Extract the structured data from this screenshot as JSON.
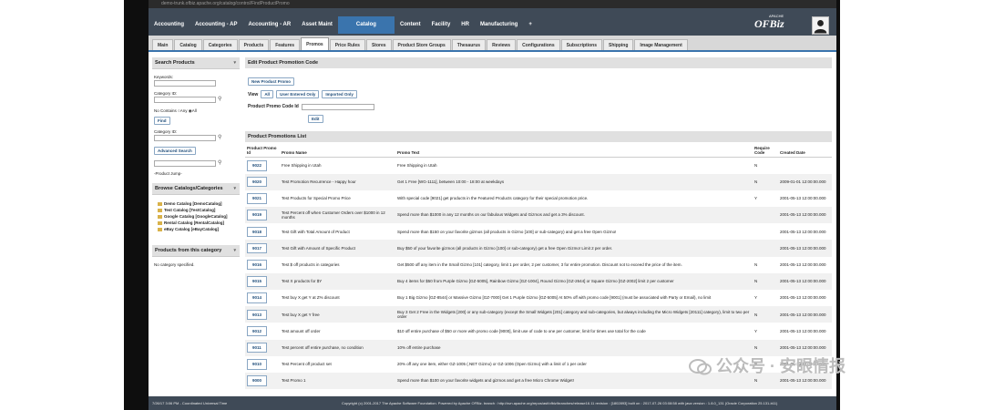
{
  "browser": {
    "url": "demo-trunk.ofbiz.apache.org/catalog/control/FindProductPromo"
  },
  "app_menu": {
    "items": [
      "Accounting",
      "Accounting - AP",
      "Accounting - AR",
      "Asset Maint",
      "Catalog",
      "Content",
      "Facility",
      "HR",
      "Manufacturing",
      "+"
    ],
    "active": "Catalog"
  },
  "brand": {
    "apache": "APACHE",
    "name": "OFBiz"
  },
  "tabs": [
    "Main",
    "Catalog",
    "Categories",
    "Products",
    "Features",
    "Promos",
    "Price Rules",
    "Stores",
    "Product Store Groups",
    "Thesaurus",
    "Reviews",
    "Configurations",
    "Subscriptions",
    "Shipping",
    "Image Management"
  ],
  "active_tab": "Promos",
  "search_products": {
    "title": "Search Products",
    "keywords_label": "Keywords:",
    "category_label": "Category ID:",
    "no_contains": "No Contains",
    "any": "Any",
    "all": "All",
    "find_btn": "Find",
    "category_label2": "Category ID:",
    "advanced_btn": "Advanced Search",
    "product_jump": "-Product Jump-"
  },
  "browse_catalogs": {
    "title": "Browse Catalogs/Categories",
    "items": [
      "Demo Catalog [DemoCatalog]",
      "Test Catalog [TestCatalog]",
      "Google Catalog [GoogleCatalog]",
      "Rental Catalog [RentalCatalog]",
      "eBay Catalog [eBayCatalog]"
    ]
  },
  "products_category": {
    "title": "Products from this category",
    "empty": "No category specified."
  },
  "edit_promo": {
    "title": "Edit Product Promotion Code",
    "new_btn": "New Product Promo",
    "view_label": "View",
    "view_all": "All",
    "view_user": "User Entered Only",
    "view_imported": "Imported Only",
    "code_label": "Product Promo Code Id",
    "edit_btn": "Edit"
  },
  "promo_list": {
    "title": "Product Promotions List",
    "headers": {
      "id": "Product Promo Id",
      "name": "Promo Name",
      "text": "Promo Text",
      "require": "Require Code",
      "created": "Created Date"
    },
    "rows": [
      {
        "id": "9022",
        "name": "Free Shipping in Utah",
        "text": "Free Shipping in Utah",
        "require": "N",
        "created": ""
      },
      {
        "id": "9020",
        "name": "Test Promotion Recurrence - Happy hour",
        "text": "Get 1 Free [WG-1111], between 10:00 - 18:00 at weekdays",
        "require": "N",
        "created": "2009-01-01 12:00:00.000"
      },
      {
        "id": "9021",
        "name": "Test Products for Special Promo Price",
        "text": "With special code [9021] get products in the Featured Products category for their special promotion price.",
        "require": "Y",
        "created": "2001-05-13 12:00:00.000"
      },
      {
        "id": "9019",
        "name": "Test Percent off when Customer Orders over $1000 in 12 months",
        "text": "Spend more than $1000 in any 12 months on our fabulous Widgets and Gizmos and get a 3% discount.",
        "require": "",
        "created": "2001-05-13 12:00:00.000"
      },
      {
        "id": "9018",
        "name": "Test Gift with Total Amount of Product",
        "text": "Spend more than $150 on your favorite gizmos (all products in Gizmo [100] or sub-category) and get a free Open Gizmo!",
        "require": "",
        "created": "2001-05-13 12:00:00.000"
      },
      {
        "id": "9017",
        "name": "Test Gift with Amount of Specific Product",
        "text": "Buy $50 of your favorite gizmos (all products in Gizmo [100] or sub-category) get a free Open Gizmo! Limit 2 per order.",
        "require": "",
        "created": "2001-05-13 12:00:00.000"
      },
      {
        "id": "9016",
        "name": "Test $ off products in categories",
        "text": "Get $500 off any item in the Small Gizmo [101] category, limit 1 per order, 2 per customer, 3 for entire promotion. Discount not to exceed the price of the item.",
        "require": "N",
        "created": "2001-05-13 12:00:00.000"
      },
      {
        "id": "9015",
        "name": "Test X products for $Y",
        "text": "Buy 4 items for $50 from Purple Gizmo [GZ-5005], Rainbow Gizmo [GZ-1004], Round Gizmo [GZ-2644] or Square Gizmo [GZ-2002] limit 2 per customer",
        "require": "N",
        "created": "2001-05-13 12:00:00.000"
      },
      {
        "id": "9014",
        "name": "Test buy X get Y at Z% discount",
        "text": "Buy 1 Big Gizmo [GZ-8544] or Massive Gizmo [GZ-7000] Get 1 Purple Gizmo [GZ-5005] At 50% off with promo code [9001] (must be associated with Party or Email), no limit",
        "require": "Y",
        "created": "2001-05-13 12:00:00.000"
      },
      {
        "id": "9013",
        "name": "Test buy X get Y free",
        "text": "Buy 3 Get 2 Free in the Widgets [200] or any sub-category (except the Small Widgets [201] category and sub-categories, but always including the Micro Widgets [20111] category), limit to two per order",
        "require": "N",
        "created": "2001-05-13 12:00:00.000"
      },
      {
        "id": "9012",
        "name": "Test amount off order",
        "text": "$10 off entire purchase of $50 or more with promo code [9000], limit use of code to one per customer, limit for times use total for the code",
        "require": "Y",
        "created": "2001-05-13 12:00:00.000"
      },
      {
        "id": "9011",
        "name": "Test percent off entire purchase, no condition",
        "text": "10% off entire purchase",
        "require": "N",
        "created": "2001-05-13 12:00:00.000"
      },
      {
        "id": "9010",
        "name": "Test Percent off product set",
        "text": "20% off any one item, either GZ-1005 (.NET Gizmo) or GZ-1006 (Open Gizmo) with a limit of 1 per order",
        "require": "N",
        "created": "2001-05-13 12:00:00.000"
      },
      {
        "id": "9000",
        "name": "Test Promo 1",
        "text": "Spend more than $100 on your favorite widgets and gizmos and get a free Micro Chrome Widget!",
        "require": "N",
        "created": "2001-05-13 12:00:00.000"
      }
    ]
  },
  "footer": {
    "left": "7/26/17 3:06 PM - Coordinated Universal Time",
    "right": "Copyright (c) 2001-2017 The Apache Software Foundation. Powered by Apache OFBiz. branch : http://svn.apache.org/repos/asf/ofbiz/branches/release16.11 revision : [1802893] built on : 2017-07-26 03:08:58 with java version : 1.8.0_131 (Oracle Corporation 25.131-b11)"
  },
  "watermark": {
    "text": "公众号 · 安眼情报"
  }
}
